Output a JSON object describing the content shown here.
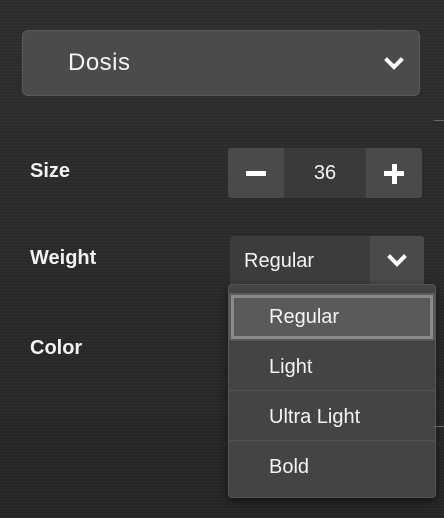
{
  "font_family": {
    "value": "Dosis",
    "icon": "chevron-down-icon"
  },
  "size": {
    "label": "Size",
    "value": "36",
    "decrement_icon": "minus-icon",
    "increment_icon": "plus-icon"
  },
  "weight": {
    "label": "Weight",
    "value": "Regular",
    "icon": "chevron-down-icon",
    "options": [
      "Regular",
      "Light",
      "Ultra Light",
      "Bold"
    ],
    "selected": "Regular"
  },
  "color": {
    "label": "Color"
  }
}
